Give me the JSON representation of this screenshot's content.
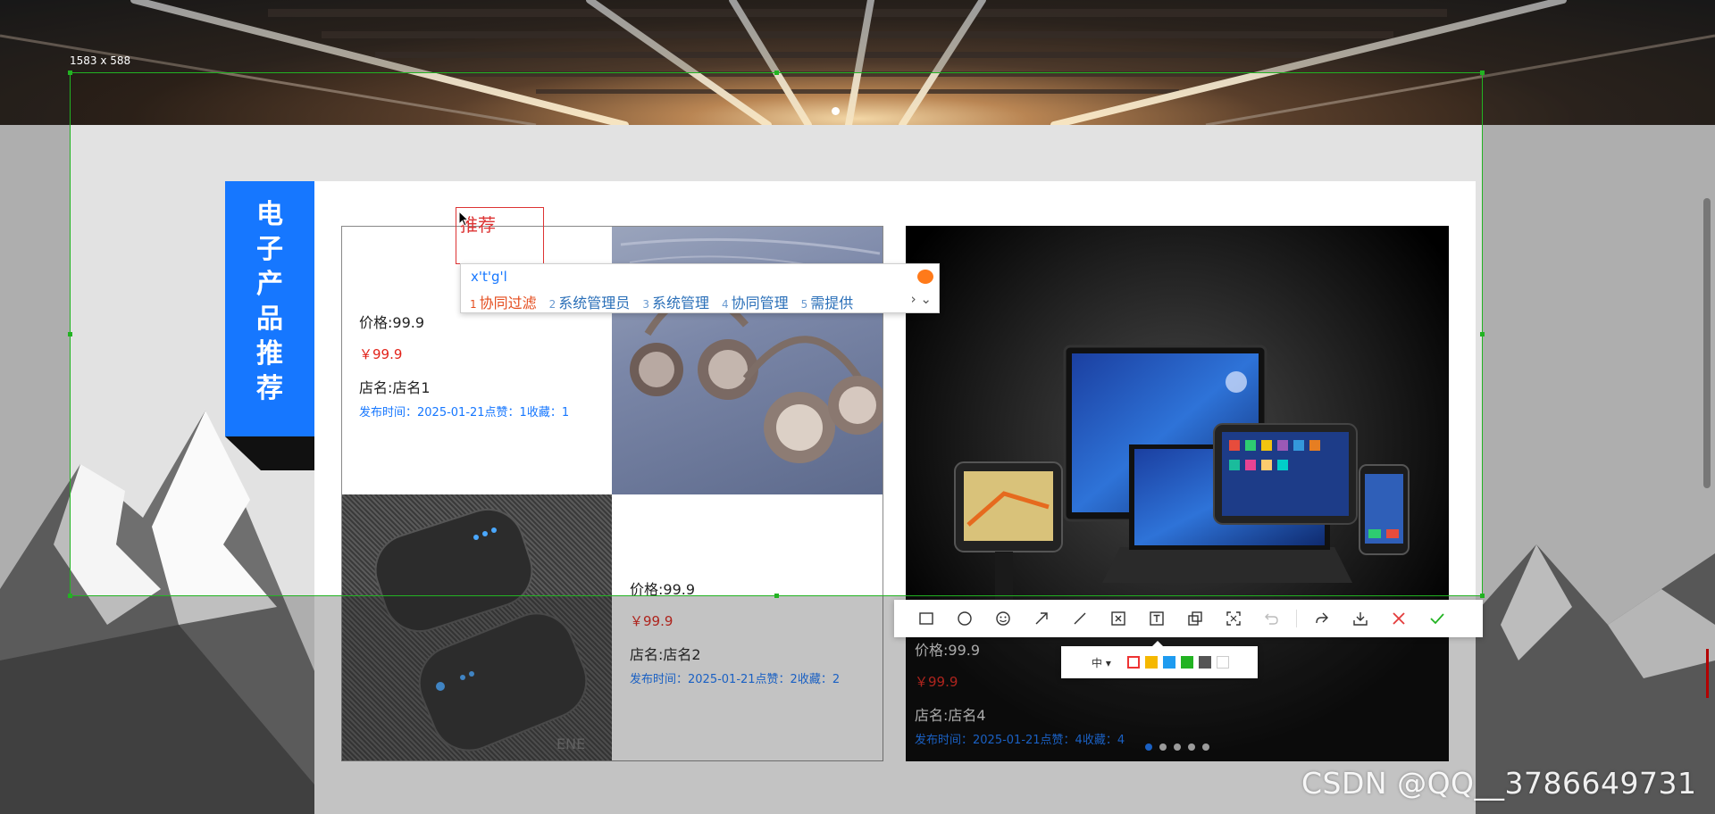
{
  "capture": {
    "size_label": "1583 x 588"
  },
  "section": {
    "tag_chars": [
      "电",
      "子",
      "产",
      "品",
      "推",
      "荐"
    ]
  },
  "products": [
    {
      "price_label": "价格:99.9",
      "price": "￥99.9",
      "shop": "店名:店名1",
      "meta": "发布时间：2025-01-21点赞：1收藏：1"
    },
    {
      "price_label": "价格:99.9",
      "price": "￥99.9",
      "shop": "店名:店名2",
      "meta": "发布时间：2025-01-21点赞：2收藏：2"
    },
    {
      "price_label": "价格:99.9",
      "price": "￥99.9",
      "shop": "店名:店名4",
      "meta": "发布时间：2025-01-21点赞：4收藏：4"
    }
  ],
  "image_watermark": "ENE",
  "annotation": {
    "text": "推荐"
  },
  "ime": {
    "input": "x't'g'l",
    "candidates": [
      {
        "n": "1",
        "text": "协同过滤"
      },
      {
        "n": "2",
        "text": "系统管理员"
      },
      {
        "n": "3",
        "text": "系统管理"
      },
      {
        "n": "4",
        "text": "协同管理"
      },
      {
        "n": "5",
        "text": "需提供"
      }
    ],
    "more": "› ⌄"
  },
  "toolbar": {
    "tools": [
      "rectangle-icon",
      "circle-icon",
      "emoji-icon",
      "arrow-icon",
      "line-icon",
      "mosaic-icon",
      "text-icon",
      "layers-icon",
      "ocr-icon",
      "undo-icon",
      "share-icon",
      "download-icon",
      "close-icon",
      "confirm-icon"
    ],
    "colors": {
      "cancel": "#e33b3b",
      "confirm": "#22b322"
    }
  },
  "subbar": {
    "size": "中 ▾",
    "swatches": [
      "#e33b3b",
      "#f5b800",
      "#1e9bf0",
      "#22b322",
      "#555555",
      "#ffffff"
    ]
  },
  "watermark": "CSDN @QQ__3786649731"
}
